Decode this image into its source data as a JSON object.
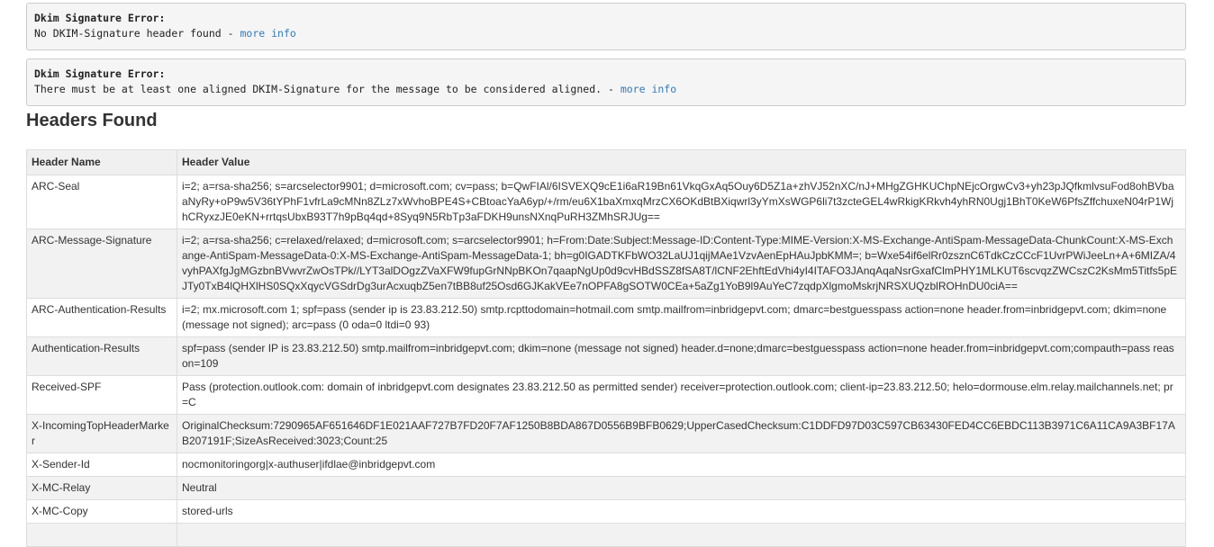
{
  "errors": [
    {
      "title": "Dkim Signature Error:",
      "message": "No DKIM-Signature header found - ",
      "link": "more info"
    },
    {
      "title": "Dkim Signature Error:",
      "message": "There must be at least one aligned DKIM-Signature for the message to be considered aligned. - ",
      "link": "more info"
    }
  ],
  "section_title": "Headers Found",
  "table": {
    "columns": [
      "Header Name",
      "Header Value"
    ],
    "rows": [
      {
        "name": "ARC-Seal",
        "value": "i=2; a=rsa-sha256; s=arcselector9901; d=microsoft.com; cv=pass; b=QwFIAl/6ISVEXQ9cE1i6aR19Bn61VkqGxAq5Ouy6D5Z1a+zhVJ52nXC/nJ+MHgZGHKUChpNEjcOrgwCv3+yh23pJQfkmlvsuFod8ohBVbaaNyRy+oP9w5V36tYPhF1vfrLa9cMNn8ZLz7xWvhoBPE4S+CBtoacYaA6yp/+/rm/eu6X1baXmxqMrzCX6OKdBtBXiqwrl3yYmXsWGP6li7t3zcteGEL4wRkigKRkvh4yhRN0Ugj1BhT0KeW6PfsZffchuxeN04rP1WjhCRyxzJE0eKN+rrtqsUbxB93T7h9pBq4qd+8Syq9N5RbTp3aFDKH9unsNXnqPuRH3ZMhSRJUg=="
      },
      {
        "name": "ARC-Message-Signature",
        "value": "i=2; a=rsa-sha256; c=relaxed/relaxed; d=microsoft.com; s=arcselector9901; h=From:Date:Subject:Message-ID:Content-Type:MIME-Version:X-MS-Exchange-AntiSpam-MessageData-ChunkCount:X-MS-Exchange-AntiSpam-MessageData-0:X-MS-Exchange-AntiSpam-MessageData-1; bh=g0IGADTKFbWO32LaUJ1qijMAe1VzvAenEpHAuJpbKMM=; b=Wxe54if6elRr0zsznC6TdkCzCCcF1UvrPWiJeeLn+A+6MIZA/4vyhPAXfgJgMGzbnBVwvrZwOsTPk//LYT3alDOgzZVaXFW9fupGrNNpBKOn7qaapNgUp0d9cvHBdSSZ8fSA8T/lCNF2EhftEdVhi4yI4ITAFO3JAnqAqaNsrGxafClmPHY1MLKUT6scvqzZWCszC2KsMm5Titfs5pEJTy0TxB4lQHXlHS0SQxXqycVGSdrDg3urAcxuqbZ5en7tBB8uf25Osd6GJKakVEe7nOPFA8gSOTW0CEa+5aZg1YoB9l9AuYeC7zqdpXlgmoMskrjNRSXUQzblROHnDU0ciA=="
      },
      {
        "name": "ARC-Authentication-Results",
        "value": "i=2; mx.microsoft.com 1; spf=pass (sender ip is 23.83.212.50) smtp.rcpttodomain=hotmail.com smtp.mailfrom=inbridgepvt.com; dmarc=bestguesspass action=none header.from=inbridgepvt.com; dkim=none (message not signed); arc=pass (0 oda=0 ltdi=0 93)"
      },
      {
        "name": "Authentication-Results",
        "value": "spf=pass (sender IP is 23.83.212.50) smtp.mailfrom=inbridgepvt.com; dkim=none (message not signed) header.d=none;dmarc=bestguesspass action=none header.from=inbridgepvt.com;compauth=pass reason=109"
      },
      {
        "name": "Received-SPF",
        "value": "Pass (protection.outlook.com: domain of inbridgepvt.com designates 23.83.212.50 as permitted sender) receiver=protection.outlook.com; client-ip=23.83.212.50; helo=dormouse.elm.relay.mailchannels.net; pr=C"
      },
      {
        "name": "X-IncomingTopHeaderMarker",
        "value": "OriginalChecksum:7290965AF651646DF1E021AAF727B7FD20F7AF1250B8BDA867D0556B9BFB0629;UpperCasedChecksum:C1DDFD97D03C597CB63430FED4CC6EBDC113B3971C6A11CA9A3BF17AB207191F;SizeAsReceived:3023;Count:25"
      },
      {
        "name": "X-Sender-Id",
        "value": "nocmonitoringorg|x-authuser|ifdlae@inbridgepvt.com"
      },
      {
        "name": "X-MC-Relay",
        "value": "Neutral"
      },
      {
        "name": "X-MC-Copy",
        "value": "stored-urls"
      },
      {
        "name": "",
        "value": ""
      }
    ]
  }
}
